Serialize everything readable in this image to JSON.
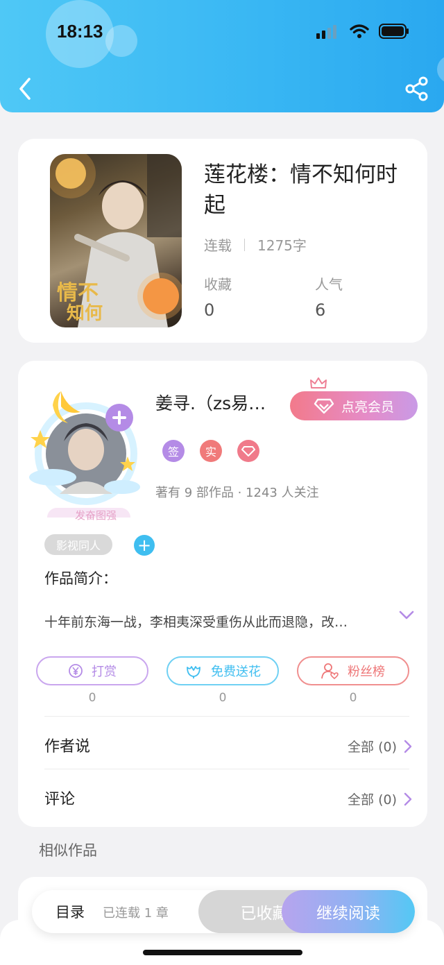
{
  "status_bar": {
    "time": "18:13"
  },
  "nav": {
    "back_icon": "chevron-left-icon",
    "share_icon": "share-icon"
  },
  "book": {
    "title": "莲花楼：情不知何时起",
    "status": "连载",
    "word_count": "1275字",
    "favorites_label": "收藏",
    "favorites_value": "0",
    "popularity_label": "人气",
    "popularity_value": "6"
  },
  "author": {
    "name": "姜寻.（zs易…",
    "avatar_caption": "发奋图强",
    "vip_button": "点亮会员",
    "badges": [
      "签",
      "实",
      "◇"
    ],
    "info": "著有 9 部作品 · 1243 人关注",
    "tag": "影视同人"
  },
  "intro": {
    "label": "作品简介：",
    "text": "十年前东海一战，李相夷深受重伤从此而退隐，改…"
  },
  "actions": [
    {
      "label": "打赏",
      "count": "0",
      "icon": "yen-icon"
    },
    {
      "label": "免费送花",
      "count": "0",
      "icon": "flower-icon"
    },
    {
      "label": "粉丝榜",
      "count": "0",
      "icon": "fan-user-icon"
    }
  ],
  "rows": {
    "author_says": {
      "label": "作者说",
      "link": "全部 (0)"
    },
    "comments": {
      "label": "评论",
      "link": "全部 (0)"
    }
  },
  "similar": {
    "title": "相似作品"
  },
  "bottom": {
    "toc": "目录",
    "chapters": "已连载 1 章",
    "favorited": "已收藏",
    "continue": "继续阅读"
  },
  "colors": {
    "header": "#38b6f3",
    "vip": "#f27a8b",
    "purple": "#b48be6",
    "cyan": "#3fbef0",
    "red": "#ee7677"
  }
}
